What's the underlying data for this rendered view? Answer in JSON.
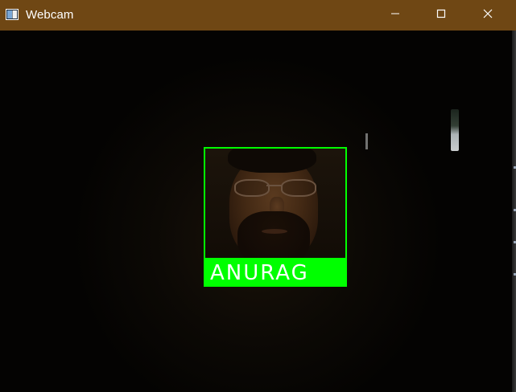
{
  "window": {
    "title": "Webcam",
    "controls": {
      "minimize_icon": "minimize-icon",
      "maximize_icon": "maximize-icon",
      "close_icon": "close-icon"
    }
  },
  "detection": {
    "label": "ANURAG",
    "box_color": "#00ff00",
    "label_text_color": "#ffffff"
  },
  "colors": {
    "titlebar": "#6f4714",
    "background": "#000000"
  }
}
